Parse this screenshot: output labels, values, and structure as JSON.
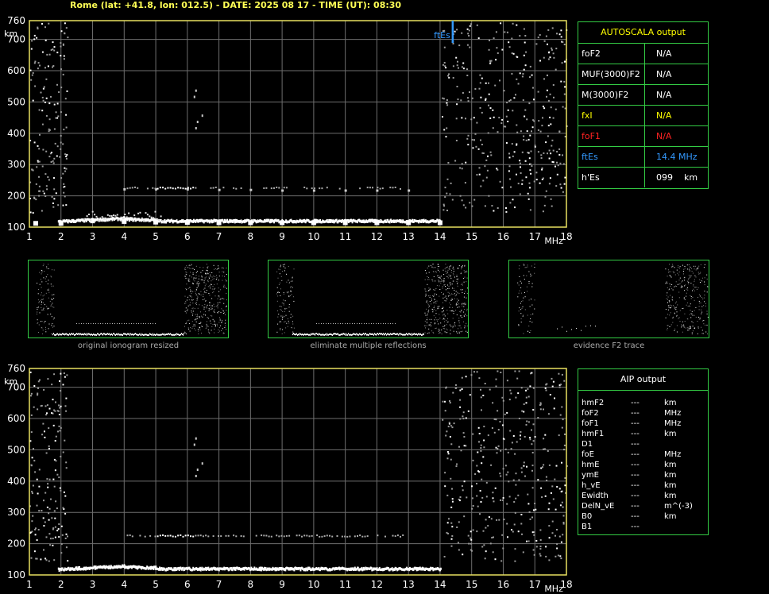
{
  "header": {
    "title": "Rome (lat: +41.8, lon: 012.5) - DATE: 2025 08 17 - TIME (UT): 08:30"
  },
  "colors": {
    "axis": "#e8e060",
    "grid": "#6e6e6e",
    "trace": "#ffffff",
    "panel_border": "#33cc44",
    "label_yellow": "#ffff00",
    "label_red": "#ff2222",
    "label_blue": "#3399ff"
  },
  "chart_data": [
    {
      "type": "scatter",
      "xlabel": "MHz",
      "ylabel": "km",
      "x_ticks": [
        "1",
        "2",
        "3",
        "4",
        "5",
        "6",
        "7",
        "8",
        "9",
        "10",
        "11",
        "12",
        "13",
        "14",
        "15",
        "16",
        "17",
        "18"
      ],
      "y_ticks": [
        "100",
        "200",
        "300",
        "400",
        "500",
        "600",
        "700",
        "760"
      ],
      "xlim": [
        1,
        18
      ],
      "ylim": [
        100,
        760
      ],
      "annotation": "ftEs",
      "ftEs_frequency": 14.4,
      "series": [
        {
          "x": [
            1.2,
            2,
            3,
            4,
            5,
            6,
            7,
            8,
            9,
            10,
            11,
            12,
            13,
            14
          ],
          "y": [
            112,
            112,
            120,
            118,
            116,
            115,
            114,
            114,
            114,
            114,
            114,
            114,
            114,
            114
          ]
        },
        {
          "x": [
            4,
            5,
            6,
            7,
            8,
            9,
            10,
            11,
            12,
            13
          ],
          "y": [
            222,
            222,
            222,
            220,
            220,
            218,
            218,
            218,
            218,
            218
          ]
        }
      ]
    },
    {
      "type": "scatter",
      "xlabel": "MHz",
      "ylabel": "km",
      "x_ticks": [
        "1",
        "2",
        "3",
        "4",
        "5",
        "6",
        "7",
        "8",
        "9",
        "10",
        "11",
        "12",
        "13",
        "14",
        "15",
        "16",
        "17",
        "18"
      ],
      "y_ticks": [
        "100",
        "200",
        "300",
        "400",
        "500",
        "600",
        "700",
        "760"
      ],
      "xlim": [
        1,
        18
      ],
      "ylim": [
        100,
        760
      ]
    }
  ],
  "autoscala": {
    "title": "AUTOSCALA output",
    "rows": [
      {
        "label": "foF2",
        "value": "N/A",
        "color": "#ffffff"
      },
      {
        "label": "MUF(3000)F2",
        "value": "N/A",
        "color": "#ffffff"
      },
      {
        "label": "M(3000)F2",
        "value": "N/A",
        "color": "#ffffff"
      },
      {
        "label": "fxI",
        "value": "N/A",
        "color": "#ffff00"
      },
      {
        "label": "foF1",
        "value": "N/A",
        "color": "#ff2222"
      },
      {
        "label": "ftEs",
        "value": "14.4 MHz",
        "color": "#3399ff"
      },
      {
        "label": "h'Es",
        "value": "099    km",
        "color": "#ffffff"
      }
    ]
  },
  "thumbnails": [
    {
      "caption": "original ionogram resized"
    },
    {
      "caption": "eliminate multiple reflections"
    },
    {
      "caption": "evidence F2 trace"
    }
  ],
  "aip": {
    "title": "AIP output",
    "rows": [
      {
        "k": "hmF2",
        "d": "---",
        "u": "km"
      },
      {
        "k": "foF2",
        "d": "---",
        "u": "MHz"
      },
      {
        "k": "foF1",
        "d": "---",
        "u": "MHz"
      },
      {
        "k": "hmF1",
        "d": "---",
        "u": "km"
      },
      {
        "k": "D1",
        "d": "---",
        "u": ""
      },
      {
        "k": "foE",
        "d": "---",
        "u": "MHz"
      },
      {
        "k": "hmE",
        "d": "---",
        "u": "km"
      },
      {
        "k": "ymE",
        "d": "---",
        "u": "km"
      },
      {
        "k": "h_vE",
        "d": "---",
        "u": "km"
      },
      {
        "k": "Ewidth",
        "d": "---",
        "u": "km"
      },
      {
        "k": "DelN_vE",
        "d": "---",
        "u": "m^(-3)"
      },
      {
        "k": "B0",
        "d": "---",
        "u": "km"
      },
      {
        "k": "B1",
        "d": "---",
        "u": ""
      }
    ]
  }
}
